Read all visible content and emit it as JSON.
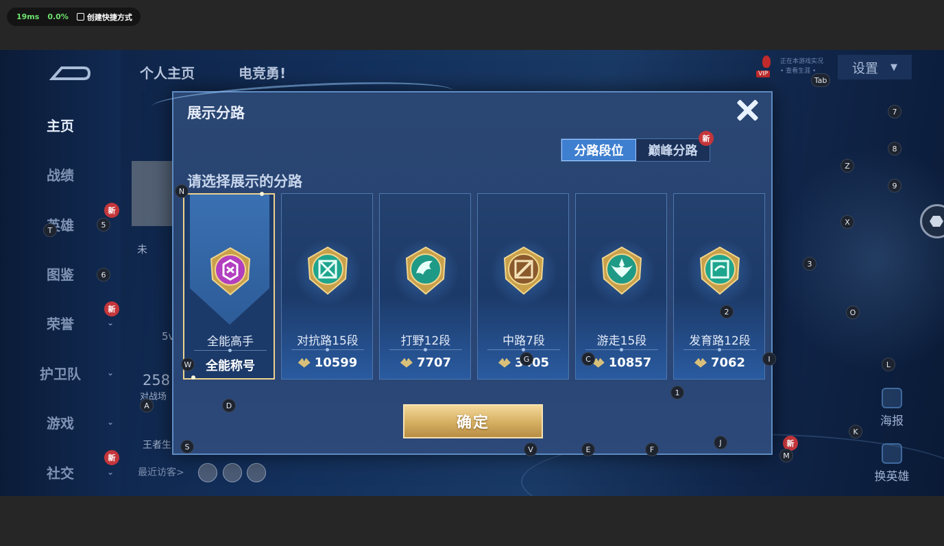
{
  "overlay": {
    "latency": "19ms",
    "loss": "0.0%",
    "shortcut_label": "创建快捷方式"
  },
  "sidebar": {
    "items": [
      {
        "label": "主页",
        "active": true,
        "new": false,
        "chevron": false
      },
      {
        "label": "战绩",
        "active": false,
        "new": false,
        "chevron": false
      },
      {
        "label": "英雄",
        "active": false,
        "new": true,
        "chevron": false
      },
      {
        "label": "图鉴",
        "active": false,
        "new": false,
        "chevron": false
      },
      {
        "label": "荣誉",
        "active": false,
        "new": true,
        "chevron": true
      },
      {
        "label": "护卫队",
        "active": false,
        "new": false,
        "chevron": true
      },
      {
        "label": "游戏",
        "active": false,
        "new": false,
        "chevron": true
      },
      {
        "label": "社交",
        "active": false,
        "new": true,
        "chevron": true
      }
    ],
    "new_label": "新",
    "chevron_glyph": "⌄"
  },
  "header": {
    "tabs": [
      "个人主页",
      "电竞勇!"
    ],
    "settings_label": "设置",
    "vip_label": "VIP",
    "live_text_1": "正在本游戏实况",
    "live_text_2": "• 查看生涯 •"
  },
  "background": {
    "stat_number": "258",
    "stat_label": "对战场",
    "king_label": "王者生",
    "visitors_label": "最近访客>",
    "partial_name": "未",
    "partial_5v": "5v",
    "poster_label": "海报",
    "change_hero_label": "换英雄",
    "floor_new": "新"
  },
  "modal": {
    "title": "展示分路",
    "tabs": [
      {
        "label": "分路段位",
        "active": true,
        "new": false
      },
      {
        "label": "巅峰分路",
        "active": false,
        "new": true
      }
    ],
    "tab_new_label": "新",
    "prompt": "请选择展示的分路",
    "lanes": [
      {
        "name": "全能高手",
        "value": "全能称号",
        "selected": true,
        "color": "#b23fc0",
        "icon": "omni-badge-icon",
        "show_points": false
      },
      {
        "name": "对抗路15段",
        "value": "10599",
        "selected": false,
        "color": "#1fa58e",
        "icon": "clash-lane-badge-icon",
        "show_points": true
      },
      {
        "name": "打野12段",
        "value": "7707",
        "selected": false,
        "color": "#1f9a86",
        "icon": "jungle-badge-icon",
        "show_points": true
      },
      {
        "name": "中路7段",
        "value": "3405",
        "selected": false,
        "color": "#8a5a2c",
        "icon": "mid-lane-badge-icon",
        "show_points": true
      },
      {
        "name": "游走15段",
        "value": "10857",
        "selected": false,
        "color": "#1f9a86",
        "icon": "roam-badge-icon",
        "show_points": true
      },
      {
        "name": "发育路12段",
        "value": "7062",
        "selected": false,
        "color": "#1fa58e",
        "icon": "farm-lane-badge-icon",
        "show_points": true
      }
    ],
    "confirm_label": "确定"
  },
  "key_hints": [
    "Tab",
    "7",
    "8",
    "Z",
    "9",
    "X",
    "3",
    "O",
    "5",
    "6",
    "T",
    "N",
    "W",
    "A",
    "D",
    "S",
    "G",
    "C",
    "I",
    "2",
    "1",
    "J",
    "V",
    "E",
    "F",
    "M",
    "K",
    "L"
  ]
}
